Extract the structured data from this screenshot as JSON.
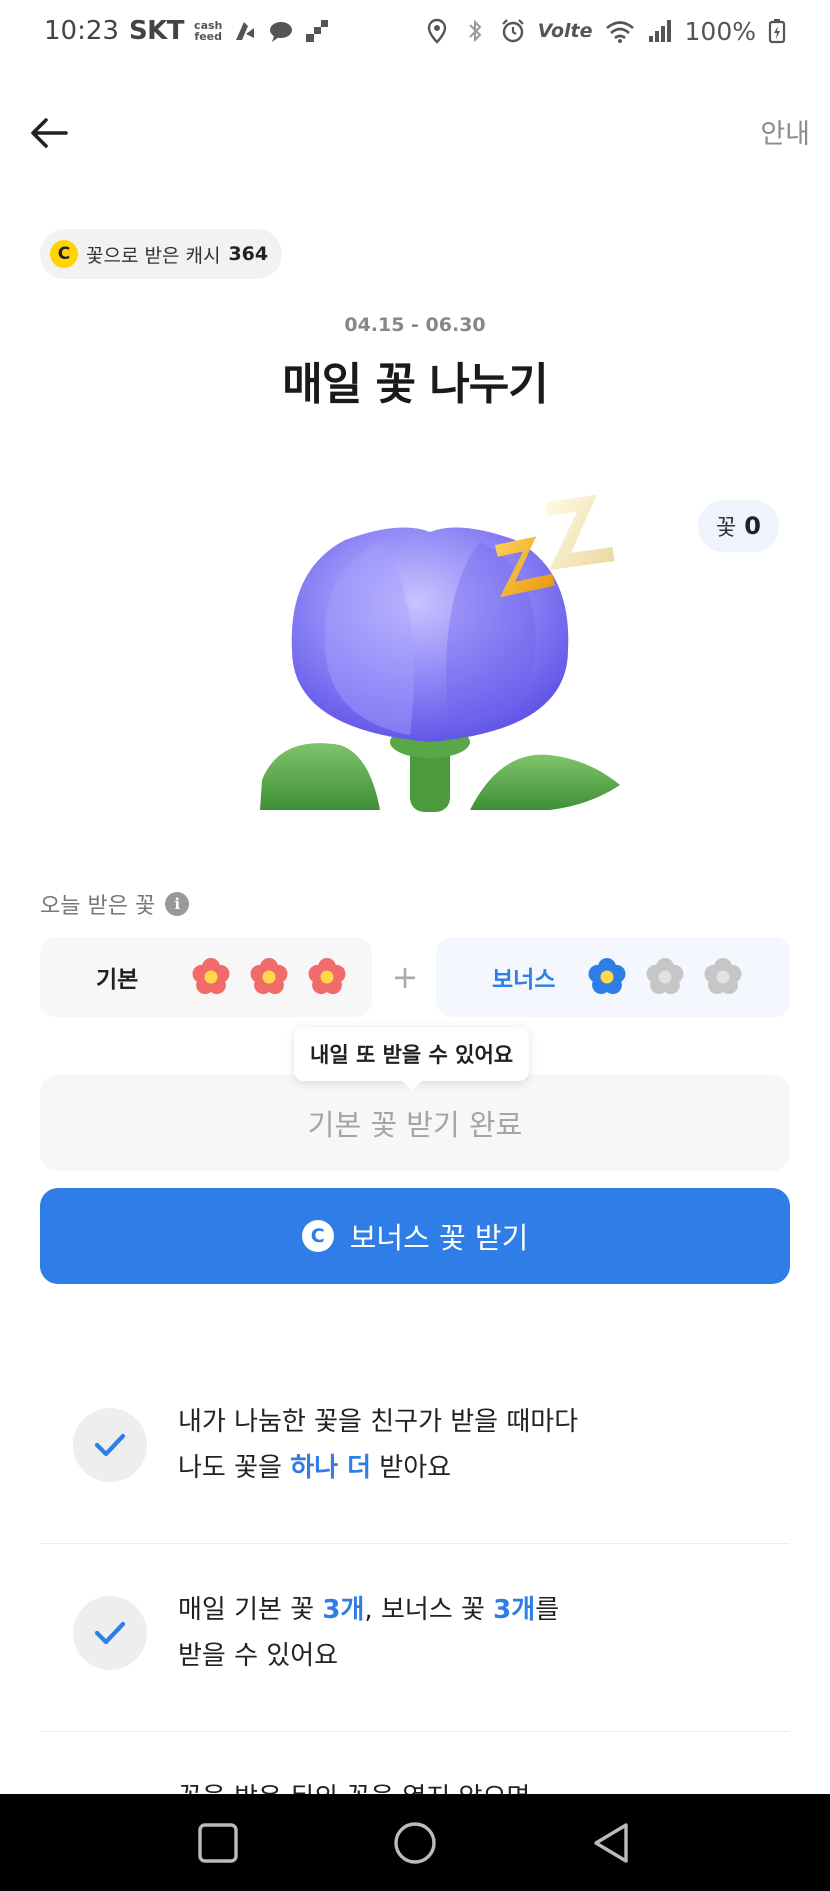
{
  "status_bar": {
    "time": "10:23",
    "carrier": "SKT",
    "mini_logo_line1": "cash",
    "mini_logo_line2": "feed",
    "volte": "Volte",
    "battery": "100%"
  },
  "header": {
    "back_icon": "arrow-left-icon",
    "guide_label": "안내"
  },
  "cash_chip": {
    "coin_letter": "C",
    "label": "꽃으로 받은 캐시",
    "amount": "364"
  },
  "event": {
    "period": "04.15 - 06.30",
    "title": "매일 꽃 나누기"
  },
  "flower_count": {
    "label": "꽃",
    "value": "0"
  },
  "today": {
    "label": "오늘 받은 꽃",
    "info_letter": "i",
    "basic": {
      "label": "기본",
      "received": 3,
      "total": 3
    },
    "plus": "+",
    "bonus": {
      "label": "보너스",
      "received": 1,
      "total": 3
    }
  },
  "tooltip": "내일 또 받을 수 있어요",
  "buttons": {
    "done_label": "기본 꽃 받기 완료",
    "bonus_coin": "C",
    "bonus_label": "보너스 꽃 받기"
  },
  "benefits": [
    {
      "line1": "내가 나눔한 꽃을 친구가 받을 때마다",
      "line2_pre": "나도 꽃을 ",
      "line2_hl": "하나 더",
      "line2_post": " 받아요"
    },
    {
      "line1_pre": "매일 기본 꽃 ",
      "line1_hl1": "3개",
      "line1_mid": ", 보너스 꽃 ",
      "line1_hl2": "3개",
      "line1_post": "를",
      "line2": "받을 수 있어요"
    }
  ],
  "cut_off_text": "꽃을 받은 뒤의 꽃을 열지 않으면",
  "colors": {
    "accent": "#2f7de6",
    "coin": "#ffd400",
    "basic_flower": "#f26b6b",
    "bonus_flower": "#2f7de6",
    "empty_flower": "#c6c6c6"
  }
}
